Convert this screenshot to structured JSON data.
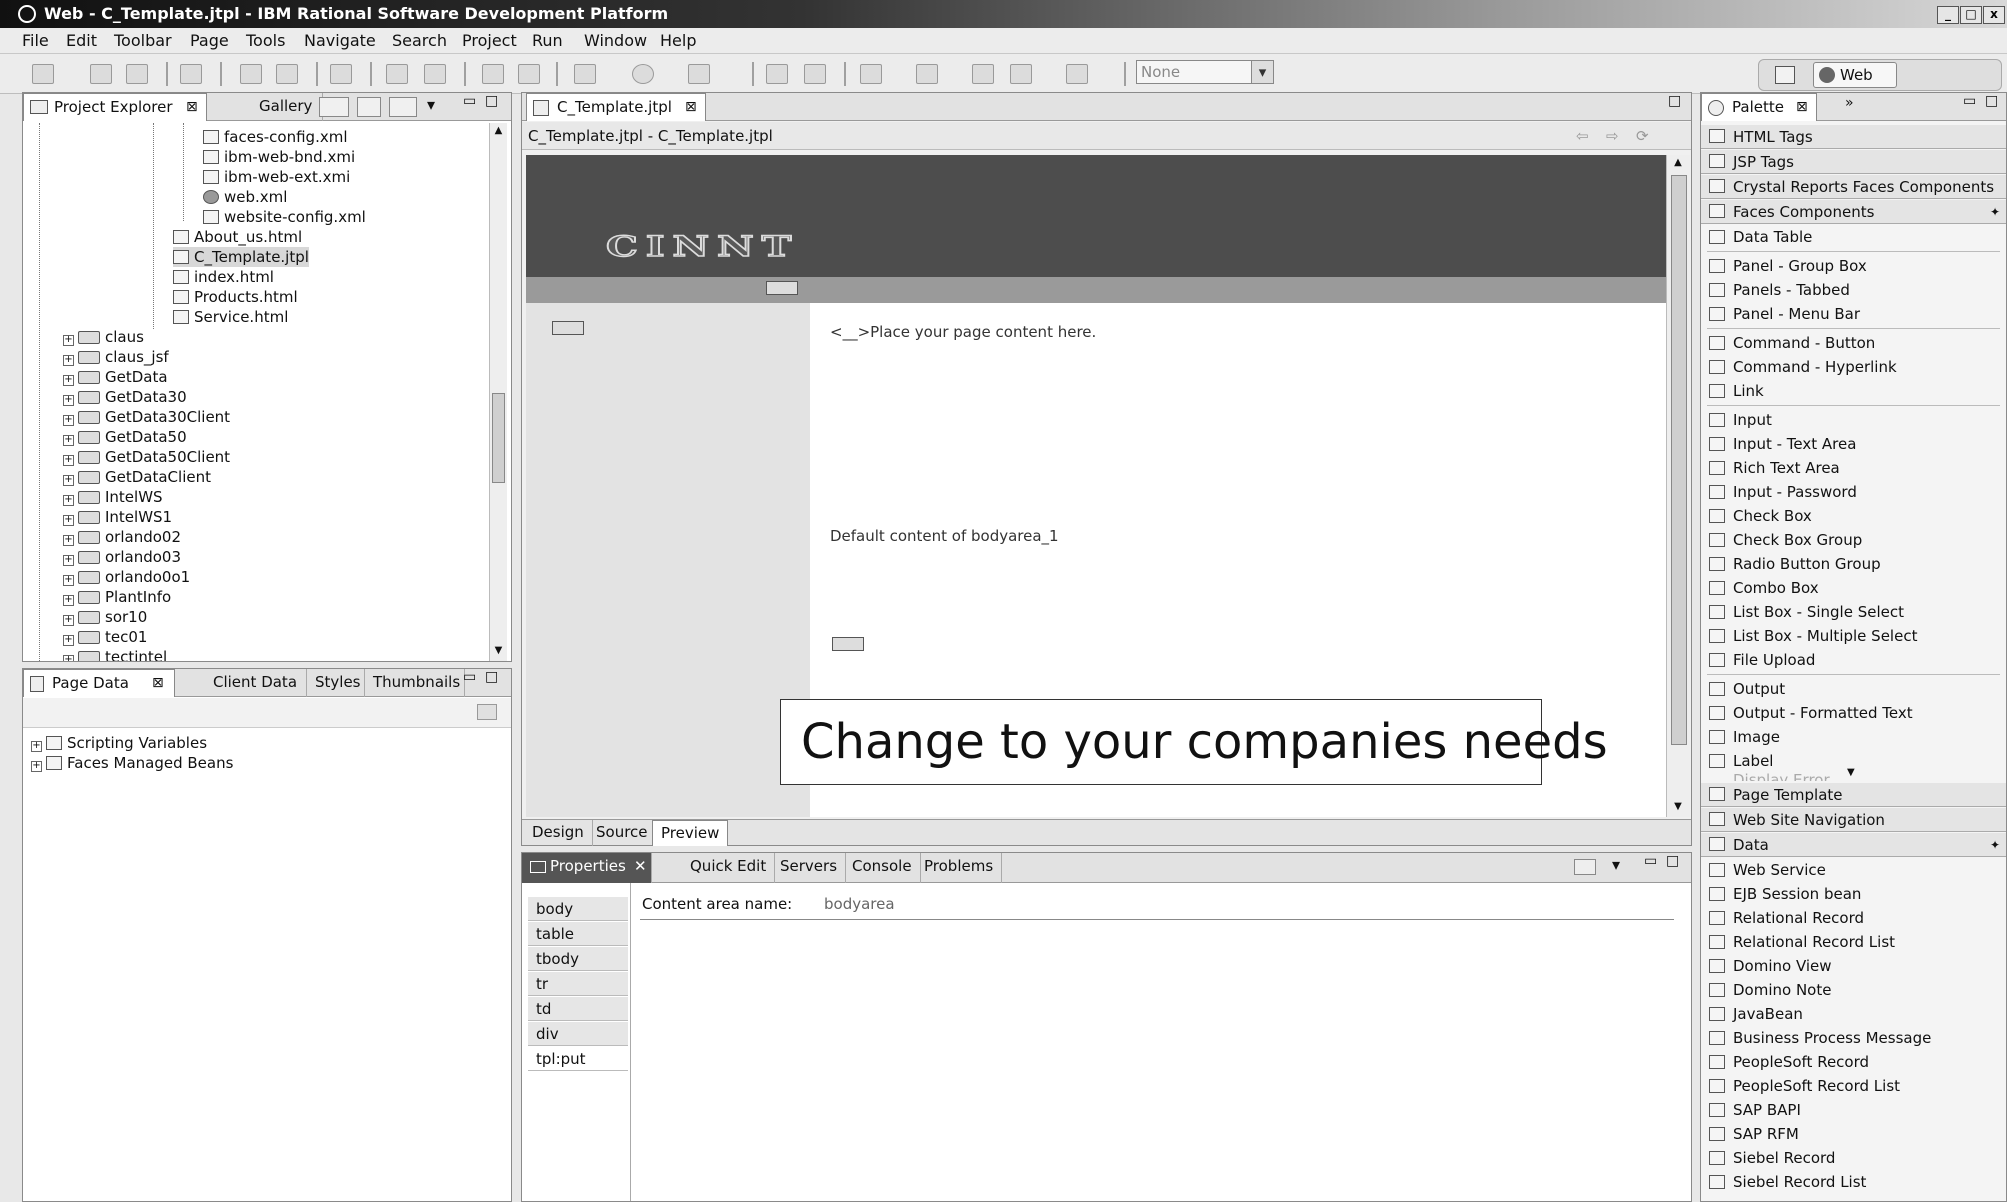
{
  "window": {
    "title": "Web - C_Template.jtpl - IBM Rational Software Development Platform"
  },
  "menu": [
    "File",
    "Edit",
    "Toolbar",
    "Page",
    "Tools",
    "Navigate",
    "Search",
    "Project",
    "Run",
    "Window",
    "Help"
  ],
  "toolbar": {
    "style_select": "None",
    "perspective": "Web"
  },
  "project_explorer": {
    "tabs": [
      "Project Explorer",
      "Gallery"
    ],
    "files": [
      "faces-config.xml",
      "ibm-web-bnd.xmi",
      "ibm-web-ext.xmi",
      "web.xml",
      "website-config.xml"
    ],
    "pages": [
      "About_us.html",
      "C_Template.jtpl",
      "index.html",
      "Products.html",
      "Service.html"
    ],
    "projects": [
      "claus",
      "claus_jsf",
      "GetData",
      "GetData30",
      "GetData30Client",
      "GetData50",
      "GetData50Client",
      "GetDataClient",
      "IntelWS",
      "IntelWS1",
      "orlando02",
      "orlando03",
      "orlando0o1",
      "PlantInfo",
      "sor10",
      "tec01",
      "tectintel"
    ]
  },
  "page_data": {
    "tabs": [
      "Page Data",
      "Client Data",
      "Styles",
      "Thumbnails"
    ],
    "items": [
      "Scripting Variables",
      "Faces Managed Beans"
    ]
  },
  "editor": {
    "tab": "C_Template.jtpl",
    "breadcrumb": "C_Template.jtpl - C_Template.jtpl",
    "banner_logo": "CINNT",
    "content_text": "Place your page content here.",
    "default_content": "Default content of bodyarea_1",
    "callout": "Change to your companies needs",
    "bottom_tabs": [
      "Design",
      "Source",
      "Preview"
    ]
  },
  "properties": {
    "tabs": [
      "Properties",
      "Quick Edit",
      "Servers",
      "Console",
      "Problems"
    ],
    "nav": [
      "body",
      "table",
      "tbody",
      "tr",
      "td",
      "div",
      "tpl:put"
    ],
    "field_label": "Content area name:",
    "field_value": "bodyarea"
  },
  "palette": {
    "title": "Palette",
    "categories_top": [
      "HTML Tags",
      "JSP Tags",
      "Crystal Reports Faces Components",
      "Faces Components"
    ],
    "faces_items": [
      [
        "Data Table"
      ],
      [
        "Panel - Group Box",
        "Panels - Tabbed",
        "Panel - Menu Bar"
      ],
      [
        "Command - Button",
        "Command - Hyperlink",
        "Link"
      ],
      [
        "Input",
        "Input - Text Area",
        "Rich Text Area",
        "Input - Password",
        "Check Box",
        "Check Box Group",
        "Radio Button Group",
        "Combo Box",
        "List Box - Single Select",
        "List Box - Multiple Select",
        "File Upload"
      ],
      [
        "Output",
        "Output - Formatted Text",
        "Image",
        "Label"
      ]
    ],
    "hidden_item": "Display Error",
    "categories_mid": [
      "Page Template",
      "Web Site Navigation",
      "Data"
    ],
    "data_items": [
      "Web Service",
      "EJB Session bean",
      "Relational Record",
      "Relational Record List",
      "Domino View",
      "Domino Note",
      "JavaBean",
      "Business Process Message",
      "PeopleSoft Record",
      "PeopleSoft Record List",
      "SAP BAPI",
      "SAP RFM",
      "Siebel Record",
      "Siebel Record List"
    ]
  }
}
